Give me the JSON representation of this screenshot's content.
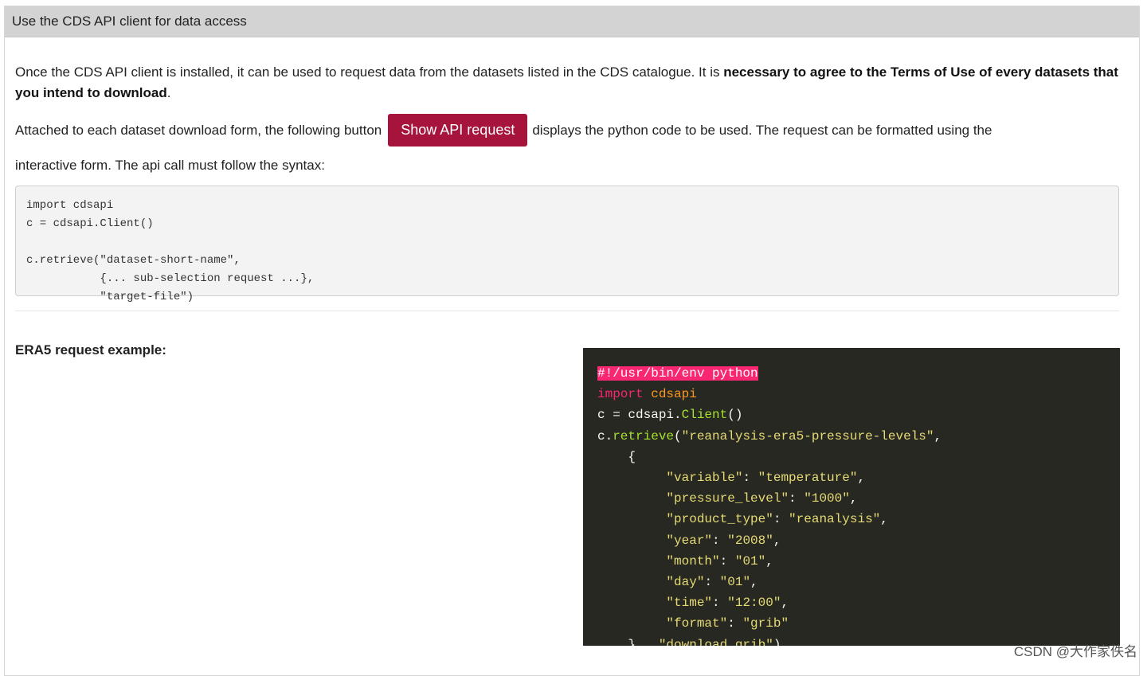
{
  "panel": {
    "title": "Use the CDS API client for data access"
  },
  "intro": {
    "text_a": "Once the CDS API client is installed, it can be used to request data from the datasets listed in the CDS catalogue. It is ",
    "text_bold": "necessary to agree to the Terms of Use of every datasets that you intend to download",
    "text_c": "."
  },
  "attached": {
    "text_before": "Attached to each dataset download form, the following button",
    "button_label": "Show API request",
    "text_after_1": "displays the python code to be used. The request can be formatted using the",
    "text_after_2": "interactive form. The api call must follow the syntax:"
  },
  "syntax_code": "import cdsapi\nc = cdsapi.Client()\n\nc.retrieve(\"dataset-short-name\",\n           {... sub-selection request ...},\n           \"target-file\")",
  "example": {
    "label": "ERA5 request example:",
    "shebang": "#!/usr/bin/env python",
    "import_kw": "import",
    "import_mod": "cdsapi",
    "line3_a": "c = cdsapi.",
    "line3_fn": "Client",
    "line3_b": "()",
    "line4_a": "c.",
    "line4_fn": "retrieve",
    "line4_b": "(",
    "line4_str": "\"reanalysis-era5-pressure-levels\"",
    "line4_c": ",",
    "brace_open": "    {",
    "entries": [
      {
        "k": "\"variable\"",
        "v": "\"temperature\"",
        "tail": ","
      },
      {
        "k": "\"pressure_level\"",
        "v": "\"1000\"",
        "tail": ","
      },
      {
        "k": "\"product_type\"",
        "v": "\"reanalysis\"",
        "tail": ","
      },
      {
        "k": "\"year\"",
        "v": "\"2008\"",
        "tail": ","
      },
      {
        "k": "\"month\"",
        "v": "\"01\"",
        "tail": ","
      },
      {
        "k": "\"day\"",
        "v": "\"01\"",
        "tail": ","
      },
      {
        "k": "\"time\"",
        "v": "\"12:00\"",
        "tail": ","
      },
      {
        "k": "\"format\"",
        "v": "\"grib\"",
        "tail": ""
      }
    ],
    "last_a": "    },  ",
    "last_str": "\"download.grib\"",
    "last_b": ")"
  },
  "watermark": "CSDN @大作家佚名",
  "colors": {
    "button": "#a6133b",
    "code_bg": "#272822",
    "header_bg": "#d3d3d3"
  }
}
